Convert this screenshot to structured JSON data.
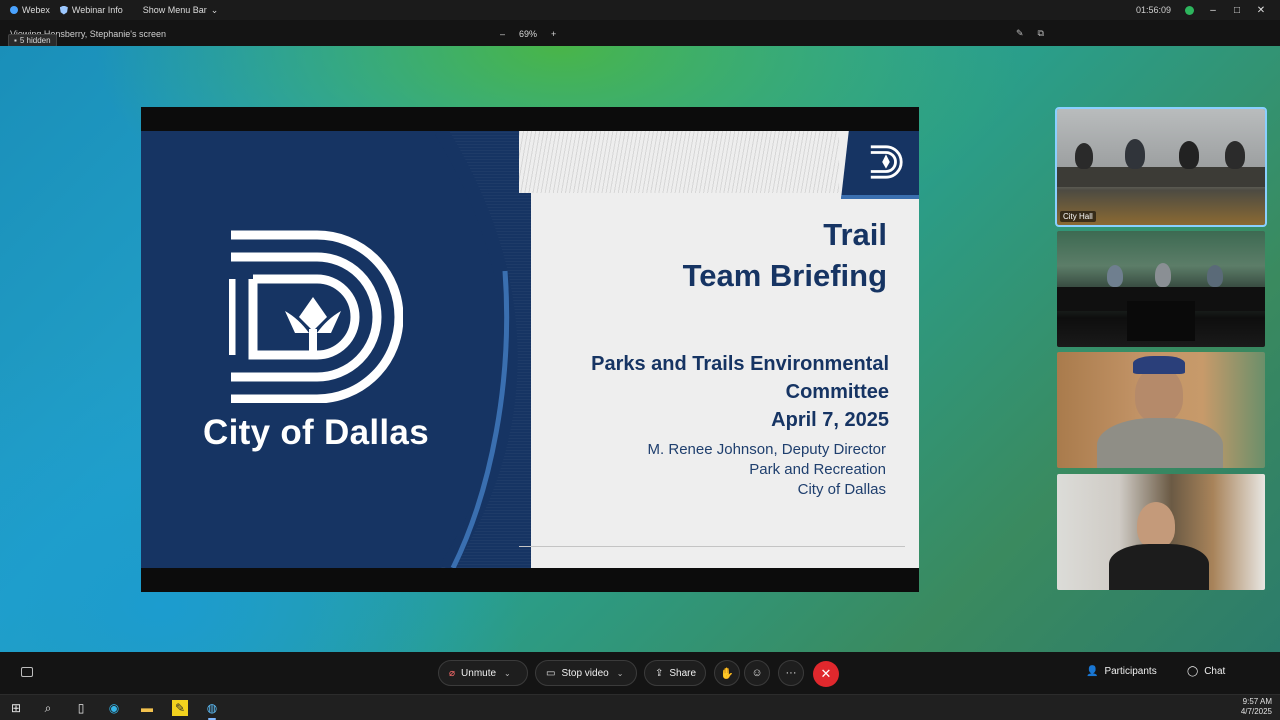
{
  "titlebar": {
    "app_name": "Webex",
    "webinar_info": "Webinar Info",
    "show_menu_bar": "Show Menu Bar",
    "timer": "01:56:09",
    "window_controls": [
      "–",
      "□",
      "✕"
    ]
  },
  "subbar": {
    "viewing_text": "Viewing Hensberry, Stephanie's screen",
    "hidden_badge": "5 hidden",
    "zoom_minus": "–",
    "zoom_level": "69%",
    "zoom_plus": "+"
  },
  "slide": {
    "city_name": "City of Dallas",
    "title_line1": "Trail",
    "title_line2": "Team Briefing",
    "subtitle_line1": "Parks and Trails Environmental",
    "subtitle_line2": "Committee",
    "date": "April 7,  2025",
    "presenter_line1": "M. Renee Johnson, Deputy  Director",
    "presenter_line2": "Park and Recreation",
    "presenter_line3": "City of Dallas",
    "brand_color": "#163463"
  },
  "video_tiles": [
    {
      "label": "City Hall"
    },
    {
      "label": ""
    },
    {
      "label": ""
    },
    {
      "label": ""
    }
  ],
  "controls": {
    "unmute": "Unmute",
    "stop_video": "Stop video",
    "share": "Share",
    "more": "···",
    "end": "✕",
    "participants": "Participants",
    "chat": "Chat"
  },
  "taskbar": {
    "time": "9:57 AM",
    "date": "4/7/2025"
  }
}
